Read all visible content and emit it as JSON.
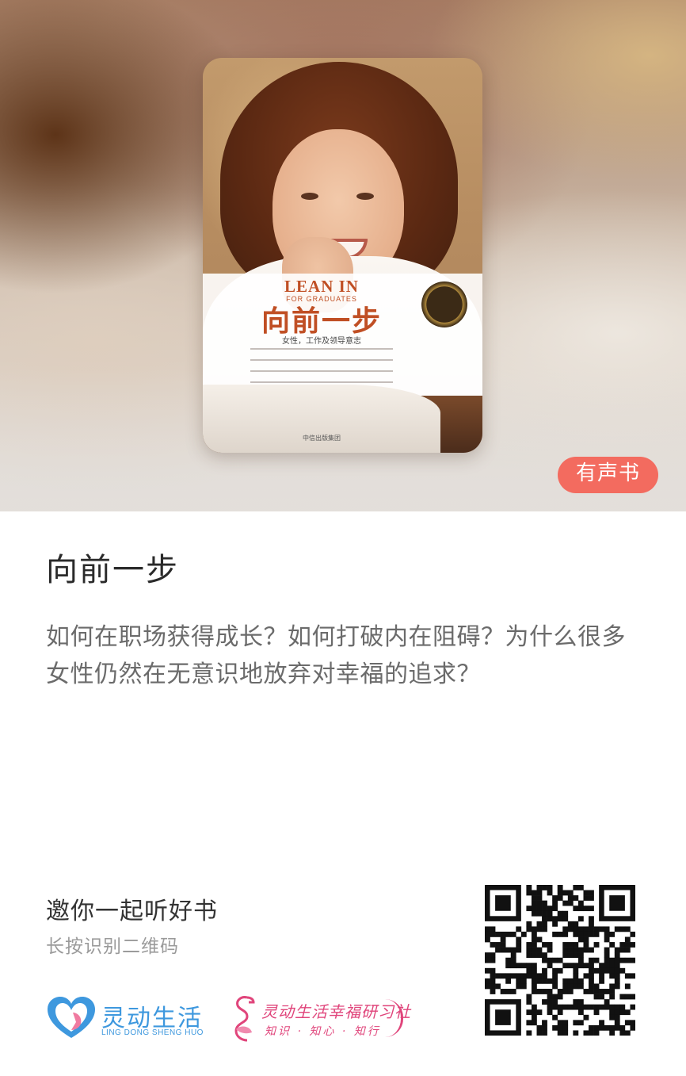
{
  "hero": {
    "cover": {
      "title": "向前一步",
      "subtitle_en": "LEAN IN",
      "subtitle_en_small": "FOR GRADUATES",
      "tagline": "女性，工作及领导意志",
      "publisher": "中信出版集团"
    },
    "badge_label": "有声书"
  },
  "book": {
    "title": "向前一步",
    "description": "如何在职场获得成长？如何打破内在阻碍？为什么很多女性仍然在无意识地放弃对幸福的追求？"
  },
  "share": {
    "invite_text": "邀你一起听好书",
    "qr_hint": "长按识别二维码"
  },
  "brands": {
    "primary": {
      "name": "灵动生活",
      "name_en": "LING DONG SHENG HUO",
      "color": "#3e98de"
    },
    "secondary": {
      "name": "灵动生活幸福研习社",
      "slogan": "知识 · 知心 · 知行",
      "color": "#e0457b"
    }
  },
  "colors": {
    "badge_bg": "#f36b5f",
    "title_text": "#2a2a2a",
    "desc_text": "#6b6b6b",
    "hint_text": "#9b9b9b"
  }
}
